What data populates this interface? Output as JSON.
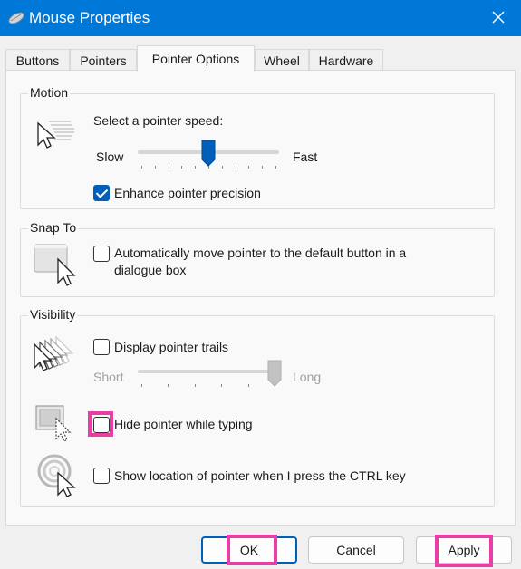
{
  "window": {
    "title": "Mouse Properties",
    "title_icon": "mouse-icon",
    "close_icon": "close-icon"
  },
  "tabs": [
    {
      "label": "Buttons",
      "active": false
    },
    {
      "label": "Pointers",
      "active": false
    },
    {
      "label": "Pointer Options",
      "active": true
    },
    {
      "label": "Wheel",
      "active": false
    },
    {
      "label": "Hardware",
      "active": false
    }
  ],
  "motion": {
    "group_label": "Motion",
    "icon": "pointer-speed-icon",
    "speed_label": "Select a pointer speed:",
    "slow_label": "Slow",
    "fast_label": "Fast",
    "speed_level": 0.5,
    "enhance_label": "Enhance pointer precision",
    "enhance_checked": true
  },
  "snap_to": {
    "group_label": "Snap To",
    "icon": "snap-to-icon",
    "auto_move_label_line1": "Automatically move pointer to the default button in a",
    "auto_move_label_line2": "dialogue box",
    "auto_move_checked": false
  },
  "visibility": {
    "group_label": "Visibility",
    "trails_icon": "pointer-trails-icon",
    "trails_label": "Display pointer trails",
    "trails_checked": false,
    "short_label": "Short",
    "long_label": "Long",
    "trail_level": 1.0,
    "hide_icon": "hide-pointer-icon",
    "hide_label": "Hide pointer while typing",
    "hide_checked": false,
    "show_location_icon": "show-location-icon",
    "show_location_label": "Show location of pointer when I press the CTRL key",
    "show_location_checked": false
  },
  "buttons": {
    "ok_label": "OK",
    "cancel_label": "Cancel",
    "apply_label": "Apply"
  },
  "colors": {
    "accent": "#005fb8",
    "titlebar": "#0078d7",
    "highlight": "#e83ea8"
  }
}
